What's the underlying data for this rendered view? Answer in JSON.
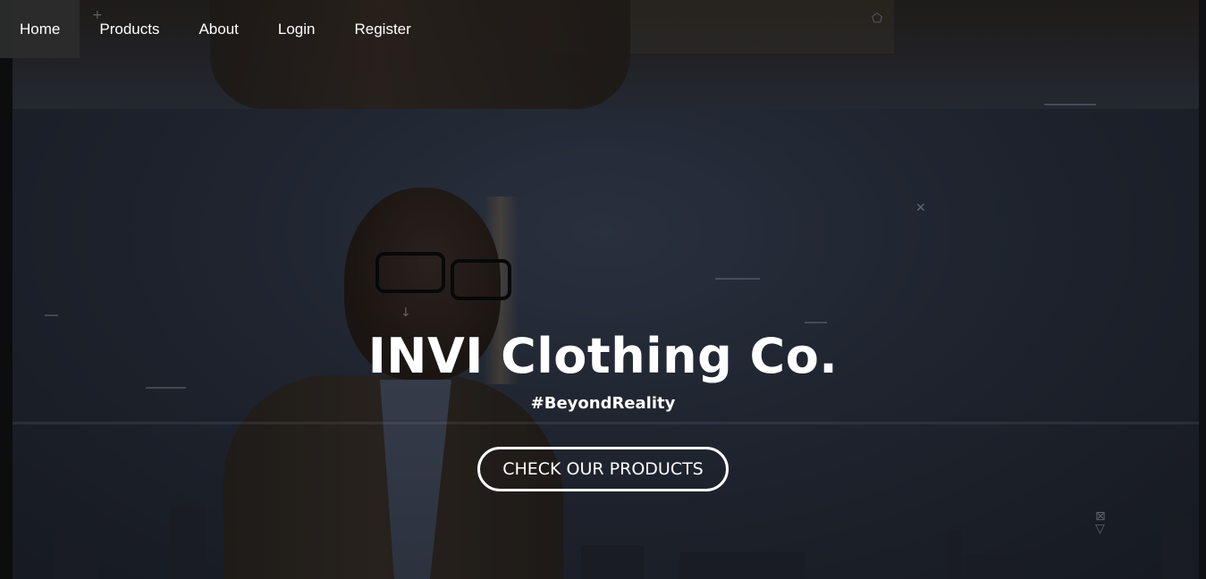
{
  "nav": {
    "items": [
      {
        "label": "Home",
        "active": true
      },
      {
        "label": "Products"
      },
      {
        "label": "About"
      },
      {
        "label": "Login"
      },
      {
        "label": "Register"
      }
    ]
  },
  "hero": {
    "title": "INVI Clothing Co.",
    "tagline": "#BeyondReality",
    "cta_label": "CHECK OUR PRODUCTS"
  },
  "colors": {
    "text": "#ffffff",
    "nav_active_bg": "#2d2d2d",
    "overlay": "#1f242e"
  },
  "icons": [
    "plus-icon",
    "close-icon",
    "arrow-down-icon",
    "shield-icon",
    "triangle-icon"
  ]
}
